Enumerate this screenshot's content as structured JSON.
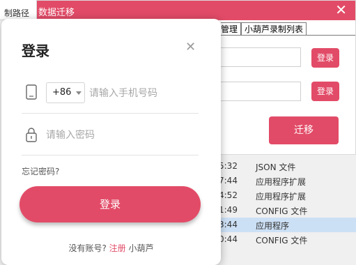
{
  "background": {
    "path_fragment": "制路径"
  },
  "migration_dialog": {
    "title": "数据迁移",
    "tabs": [
      "管理",
      "小葫芦录制列表"
    ],
    "login_label_1": "登录",
    "login_label_2": "登录",
    "migrate_label": "迁移",
    "accent_color": "#e24b67"
  },
  "file_list": [
    {
      "time": "5:32",
      "type": "JSON 文件",
      "selected": false
    },
    {
      "time": "7:44",
      "type": "应用程序扩展",
      "selected": false
    },
    {
      "time": "4:52",
      "type": "应用程序扩展",
      "selected": false
    },
    {
      "time": "1:49",
      "type": "CONFIG 文件",
      "selected": false
    },
    {
      "time": "3:44",
      "type": "应用程序",
      "selected": true
    },
    {
      "time": "0:44",
      "type": "CONFIG 文件",
      "selected": false
    }
  ],
  "login_dialog": {
    "title": "登录",
    "country_code": "+86",
    "phone_placeholder": "请输入手机号码",
    "password_placeholder": "请输入密码",
    "forgot_password": "忘记密码?",
    "login_button": "登录",
    "no_account": "没有账号?",
    "register": "注册",
    "brand": "小葫芦",
    "icons": [
      "close-icon",
      "phone-icon",
      "chevron-down-icon",
      "lock-icon"
    ]
  }
}
